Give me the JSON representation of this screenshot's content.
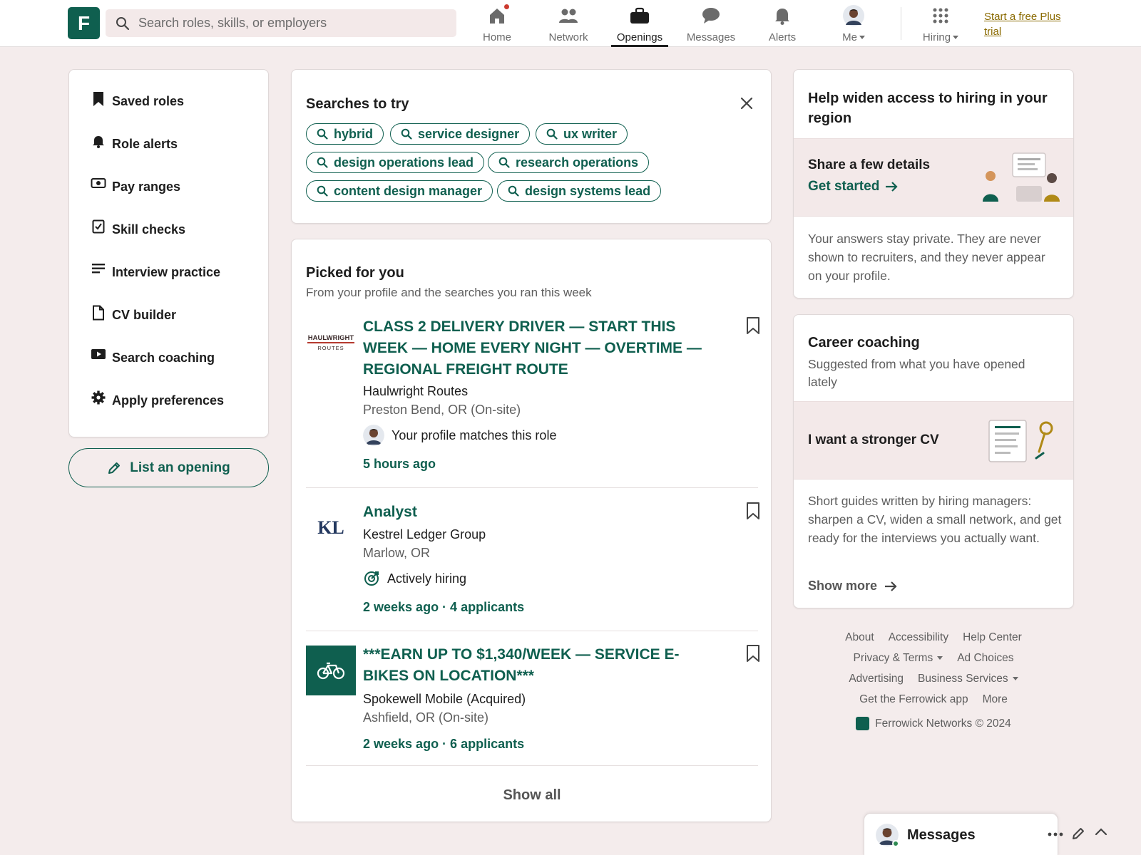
{
  "topnav": {
    "logo_letter": "F",
    "search_placeholder": "Search roles, skills, or employers",
    "items": [
      {
        "label": "Home",
        "icon": "home-icon"
      },
      {
        "label": "Network",
        "icon": "people-icon"
      },
      {
        "label": "Openings",
        "icon": "briefcase-icon"
      },
      {
        "label": "Messages",
        "icon": "chat-icon"
      },
      {
        "label": "Alerts",
        "icon": "bell-icon"
      },
      {
        "label": "Me",
        "icon": "avatar"
      },
      {
        "label": "Hiring",
        "icon": "grid-icon"
      }
    ],
    "active": "Openings",
    "plus_link": "Start a free Plus trial"
  },
  "sidebar": {
    "items": [
      {
        "label": "Saved roles",
        "icon": "bookmark-icon"
      },
      {
        "label": "Role alerts",
        "icon": "bell-icon"
      },
      {
        "label": "Pay ranges",
        "icon": "money-icon"
      },
      {
        "label": "Skill checks",
        "icon": "checkbox-icon"
      },
      {
        "label": "Interview practice",
        "icon": "notes-icon"
      },
      {
        "label": "CV builder",
        "icon": "document-icon"
      },
      {
        "label": "Search coaching",
        "icon": "video-icon"
      },
      {
        "label": "Apply preferences",
        "icon": "gear-icon"
      }
    ],
    "list_opening_label": "List an opening"
  },
  "searches": {
    "title": "Searches to try",
    "chips": [
      "hybrid",
      "service designer",
      "ux writer",
      "design operations lead",
      "research operations",
      "content design manager",
      "design systems lead"
    ]
  },
  "picked": {
    "title": "Picked for you",
    "subtitle": "From your profile and the searches you ran this week",
    "jobs": [
      {
        "title": "CLASS 2 DELIVERY DRIVER — START THIS WEEK — HOME EVERY NIGHT — OVERTIME — REGIONAL FREIGHT ROUTE",
        "company": "Haulwright Routes",
        "location": "Preston Bend, OR (On-site)",
        "insight": "Your profile matches this role",
        "meta": "5 hours ago",
        "logo_top": "HAULWRIGHT",
        "logo_bottom": "ROUTES"
      },
      {
        "title": "Analyst",
        "company": "Kestrel Ledger Group",
        "location": "Marlow, OR",
        "insight": "Actively hiring",
        "meta": "2 weeks ago · 4 applicants",
        "logo_text": "KL"
      },
      {
        "title": "***EARN UP TO $1,340/WEEK — SERVICE E-BIKES ON LOCATION***",
        "company": "Spokewell Mobile (Acquired)",
        "location": "Ashfield, OR (On-site)",
        "meta": "2 weeks ago · 6 applicants"
      }
    ],
    "show_all": "Show all"
  },
  "widen": {
    "title": "Help widen access to hiring in your region",
    "band_title": "Share a few details",
    "band_link": "Get started",
    "body": "Your answers stay private. They are never shown to recruiters, and they never appear on your profile."
  },
  "coaching": {
    "title": "Career coaching",
    "subtitle": "Suggested from what you have opened lately",
    "band_title": "I want a stronger CV",
    "body": "Short guides written by hiring managers: sharpen a CV, widen a small network, and get ready for the interviews you actually want.",
    "show_more": "Show more"
  },
  "footer": {
    "rows": [
      [
        "About",
        "Accessibility",
        "Help Center"
      ],
      [
        "Privacy & Terms",
        "Ad Choices"
      ],
      [
        "Advertising",
        "Business Services"
      ],
      [
        "Get the Ferrowick app",
        "More"
      ]
    ],
    "copyright": "Ferrowick Networks © 2024"
  },
  "messaging": {
    "label": "Messages"
  },
  "colors": {
    "brand": "#0f5f4f",
    "page_bg": "#f4ecec",
    "plus_link": "#8a6a00",
    "notification_dot": "#cc3a2f"
  }
}
